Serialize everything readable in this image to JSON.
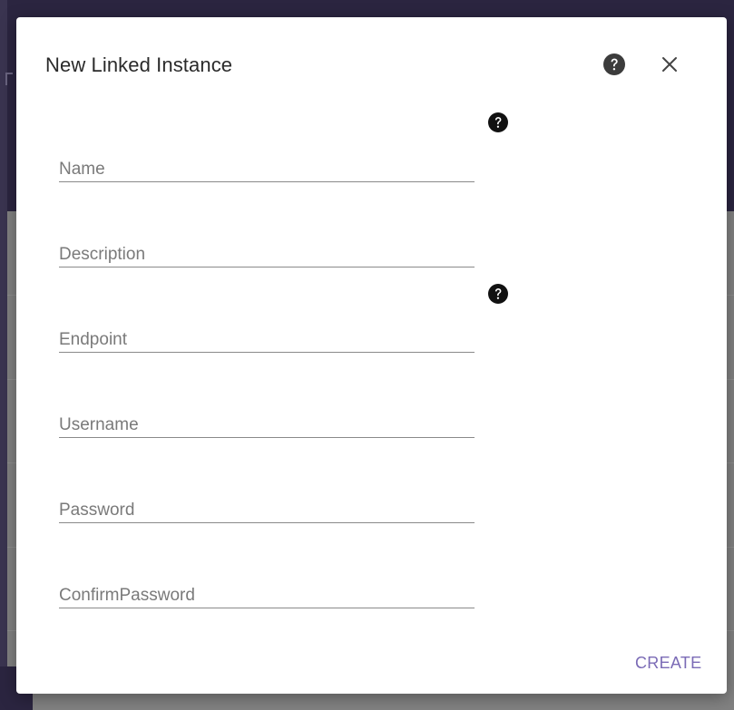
{
  "dialog": {
    "title": "New Linked Instance",
    "header_icons": [
      "help-icon",
      "close-icon"
    ],
    "fields": [
      {
        "key": "name",
        "placeholder": "Name",
        "value": "",
        "has_help": true
      },
      {
        "key": "description",
        "placeholder": "Description",
        "value": "",
        "has_help": false
      },
      {
        "key": "endpoint",
        "placeholder": "Endpoint",
        "value": "",
        "has_help": true
      },
      {
        "key": "username",
        "placeholder": "Username",
        "value": "",
        "has_help": false
      },
      {
        "key": "password",
        "placeholder": "Password",
        "value": "",
        "has_help": false
      },
      {
        "key": "confirm_password",
        "placeholder": "ConfirmPassword",
        "value": "",
        "has_help": false
      }
    ],
    "create_label": "CREATE"
  },
  "colors": {
    "accent": "#7b6bb6",
    "title_text": "#2a2a2a",
    "placeholder_text": "#7a7a7a",
    "underline": "#8a8a8a",
    "icon": "#222222",
    "overlay_dark": "#2b2540"
  }
}
